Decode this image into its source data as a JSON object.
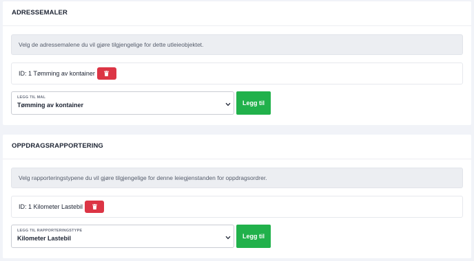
{
  "colors": {
    "page_background": "#f1f3f8",
    "card_background": "#ffffff",
    "delete_red": "#dc3545",
    "add_green": "#21b14b"
  },
  "address_templates": {
    "title": "ADRESSEMALER",
    "info": "Velg de adressemalene du vil gjøre tilgjengelige for dette utleieobjektet.",
    "items": [
      {
        "label": "ID: 1 Tømming av kontainer",
        "delete_icon": "trash-icon"
      }
    ],
    "select_label": "LEGG TIL MAL",
    "select_value": "Tømming av kontainer",
    "add_button": "Legg til"
  },
  "assignment_reporting": {
    "title": "OPPDRAGSRAPPORTERING",
    "info": "Velg rapporteringstypene du vil gjøre tilgjengelige for denne leiegjenstanden for oppdragsordrer.",
    "items": [
      {
        "label": "ID: 1 Kilometer Lastebil",
        "delete_icon": "trash-icon"
      }
    ],
    "select_label": "LEGG TIL RAPPORTERINGSTYPE",
    "select_value": "Kilometer Lastebil",
    "add_button": "Legg til"
  }
}
